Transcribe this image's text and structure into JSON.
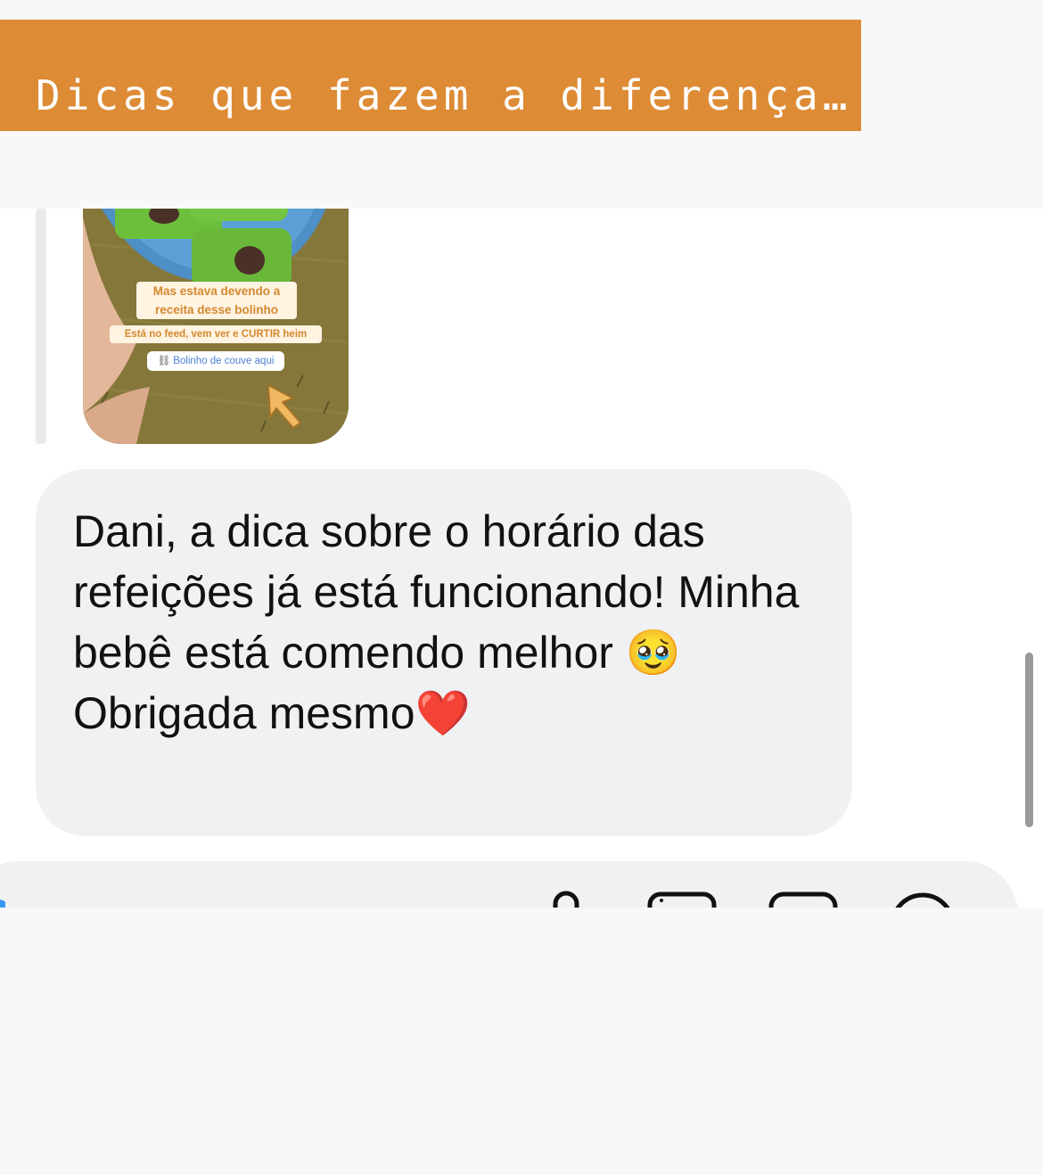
{
  "banner": {
    "title": "Dicas que fazem a diferença…",
    "background_color": "#dd8b35"
  },
  "story_reply": {
    "caption_line_1": "Mas estava devendo a receita desse bolinho",
    "caption_line_2": "Está no feed, vem ver e CURTIR heim",
    "link_text": "Bolinho de couve aqui",
    "link_icon": "link-icon",
    "pointer_icon": "pointing-arrow-icon"
  },
  "message": {
    "text": "Dani, a dica sobre o horário das refeições já está funcionando! Minha bebê está comendo melhor 🥹\nObrigada mesmo❤️"
  },
  "composer": {
    "icons": [
      "camera-icon",
      "microphone-icon",
      "gallery-icon",
      "sticker-icon",
      "plus-icon"
    ]
  },
  "colors": {
    "bubble": "#eff1f3",
    "accent": "#dd8b35"
  }
}
